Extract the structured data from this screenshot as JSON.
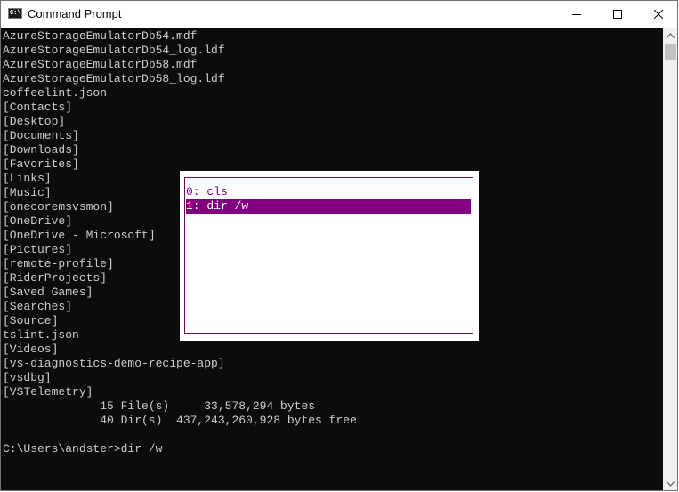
{
  "window": {
    "title": "Command Prompt",
    "icon_text": "C:\\."
  },
  "console": {
    "lines": [
      "AzureStorageEmulatorDb54.mdf",
      "AzureStorageEmulatorDb54_log.ldf",
      "AzureStorageEmulatorDb58.mdf",
      "AzureStorageEmulatorDb58_log.ldf",
      "coffeelint.json",
      "[Contacts]",
      "[Desktop]",
      "[Documents]",
      "[Downloads]",
      "[Favorites]",
      "[Links]",
      "[Music]",
      "[onecoremsvsmon]",
      "[OneDrive]",
      "[OneDrive - Microsoft]",
      "[Pictures]",
      "[remote-profile]",
      "[RiderProjects]",
      "[Saved Games]",
      "[Searches]",
      "[Source]",
      "tslint.json",
      "[Videos]",
      "[vs-diagnostics-demo-recipe-app]",
      "[vsdbg]",
      "[VSTelemetry]",
      "              15 File(s)     33,578,294 bytes",
      "              40 Dir(s)  437,243,260,928 bytes free",
      "",
      "C:\\Users\\andster>dir /w"
    ]
  },
  "history_popup": {
    "items": [
      {
        "label": "0: cls",
        "selected": false
      },
      {
        "label": "1: dir /w",
        "selected": true
      }
    ],
    "accent_color": "#800080"
  },
  "colors": {
    "console_bg": "#0c0c0c",
    "console_text": "#cccccc"
  },
  "icons": {
    "minimize": "minimize-icon",
    "maximize": "maximize-icon",
    "close": "close-icon",
    "scroll_up": "scroll-up-arrow-icon",
    "scroll_down": "scroll-down-arrow-icon"
  }
}
